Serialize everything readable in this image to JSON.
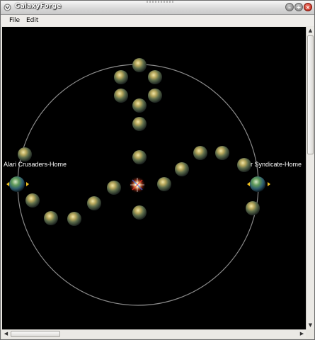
{
  "window": {
    "title": "GalaxyForge"
  },
  "menu": {
    "items": [
      "File",
      "Edit"
    ]
  },
  "map": {
    "home_labels": {
      "left": "Alari Crusaders-Home",
      "right": "r Syndicate-Home"
    },
    "colors": {
      "background": "#000000",
      "orbit": "#8a8a8a",
      "label": "#ffffff",
      "marker": "#f0c020"
    }
  },
  "scrollbars": {
    "vertical": "visible",
    "horizontal": "visible"
  }
}
